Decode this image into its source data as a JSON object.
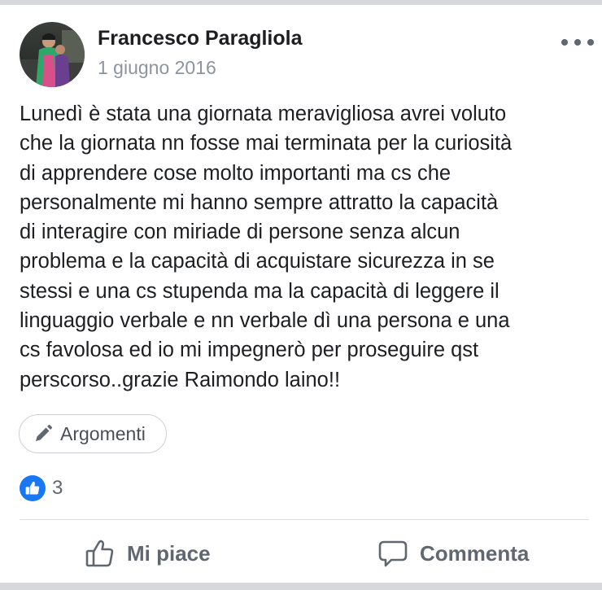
{
  "post": {
    "author": "Francesco Paragliola",
    "date": "1 giugno 2016",
    "text": "Lunedì è stata una giornata meravigliosa avrei voluto\nche la giornata nn fosse mai terminata per la curiosità\ndi apprendere cose molto importanti ma cs che\npersonalmente mi hanno sempre attratto la capacità\ndi interagire con miriade di persone senza alcun\nproblema e la capacità di acquistare sicurezza in se\nstessi e una cs stupenda ma la capacità di leggere il\nlinguaggio verbale e nn verbale dì una persona e una\ncs favolosa ed io mi impegnerò per proseguire qst\nperscorso..grazie Raimondo laino!!",
    "topics_label": "Argomenti",
    "reactions": {
      "type": "like",
      "count": "3"
    }
  },
  "actions": {
    "like_label": "Mi piace",
    "comment_label": "Commenta"
  },
  "icons": {
    "more": "more-horizontal-icon",
    "topics": "pencil-icon",
    "reaction": "like-reaction-icon",
    "like": "thumbs-up-icon",
    "comment": "comment-bubble-icon"
  },
  "colors": {
    "text": "#1c1e21",
    "secondary_text": "#8d949e",
    "action_text": "#606770",
    "like_blue": "#1877f2",
    "divider": "#dadde1",
    "band": "#d7d8dc"
  }
}
